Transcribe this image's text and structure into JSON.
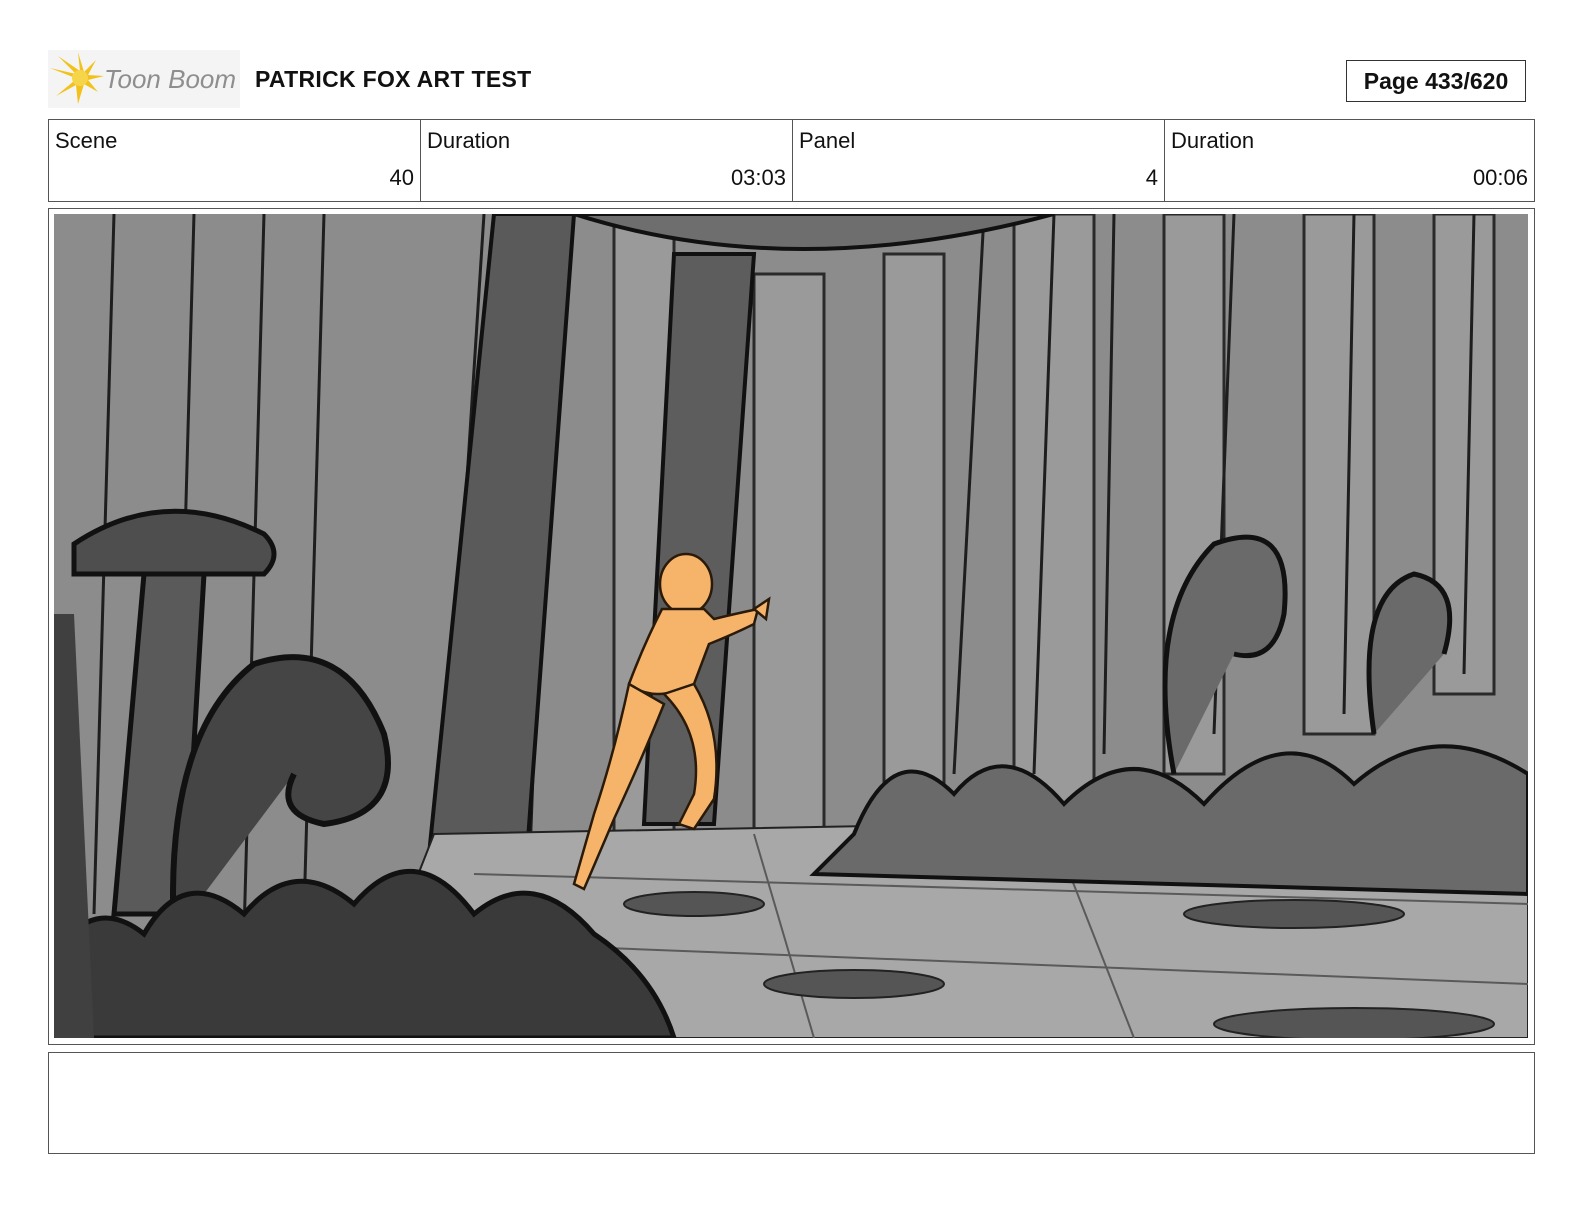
{
  "header": {
    "logo_text": "Toon Boom",
    "project_title": "PATRICK FOX ART TEST",
    "page_label": "Page 433/620"
  },
  "info": {
    "scene_label": "Scene",
    "scene_value": "40",
    "scene_duration_label": "Duration",
    "scene_duration_value": "03:03",
    "panel_label": "Panel",
    "panel_value": "4",
    "panel_duration_label": "Duration",
    "panel_duration_value": "00:06"
  },
  "panel_image": {
    "icon": "forest-sketch-image",
    "character_color": "#f6b46a",
    "background_color": "#8c8c8c"
  },
  "notes": {
    "text": ""
  }
}
